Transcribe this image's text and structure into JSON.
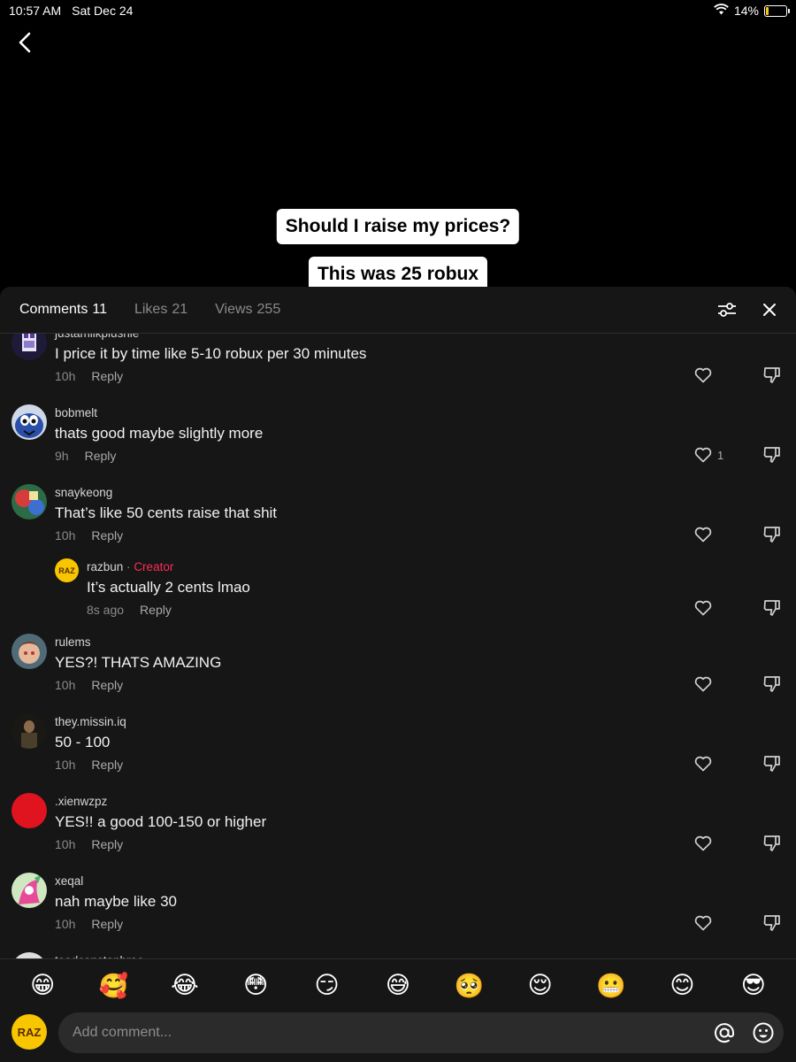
{
  "status_bar": {
    "time": "10:57 AM",
    "date": "Sat Dec 24",
    "battery": "14%",
    "battery_level": 0.14
  },
  "video": {
    "caption_1": "Should I raise my prices?",
    "caption_2": "This was 25 robux"
  },
  "tabs": [
    {
      "label": "Comments",
      "count": "11"
    },
    {
      "label": "Likes",
      "count": "21"
    },
    {
      "label": "Views",
      "count": "255"
    }
  ],
  "comments": [
    {
      "username": "justamilkplushie",
      "text": "I price it by time like 5-10 robux per 30 minutes",
      "time": "10h",
      "reply": "Reply",
      "likes": ""
    },
    {
      "username": "bobmelt",
      "text": "thats good maybe slightly more",
      "time": "9h",
      "reply": "Reply",
      "likes": "1"
    },
    {
      "username": "snaykeong",
      "text": "That’s like 50 cents raise that shit",
      "time": "10h",
      "reply": "Reply",
      "likes": ""
    },
    {
      "username": "razbun",
      "badge": "Creator",
      "separator": "·",
      "text": "It’s actually 2 cents lmao",
      "time": "8s ago",
      "reply": "Reply",
      "likes": ""
    },
    {
      "username": "rulems",
      "text": "YES?! THATS AMAZING",
      "time": "10h",
      "reply": "Reply",
      "likes": ""
    },
    {
      "username": "they.missin.iq",
      "text": "50 - 100",
      "time": "10h",
      "reply": "Reply",
      "likes": ""
    },
    {
      "username": ".xienwzpz",
      "text": "YES!! a good 100-150 or higher",
      "time": "10h",
      "reply": "Reply",
      "likes": ""
    },
    {
      "username": "xeqal",
      "text": "nah maybe like 30",
      "time": "10h",
      "reply": "Reply",
      "likes": ""
    },
    {
      "username": "teadconstanbrae",
      "text": "",
      "time": "",
      "reply": "",
      "likes": ""
    }
  ],
  "emojis": [
    "😁",
    "🥰",
    "😂",
    "😳",
    "😏",
    "😅",
    "🥺",
    "😌",
    "😬",
    "😊",
    "😎"
  ],
  "input": {
    "placeholder": "Add comment...",
    "avatar_text": "RAZ"
  },
  "colors": {
    "creator": "#fe2c55",
    "panel_bg": "#161616",
    "avatar_yellow": "#f7c600"
  }
}
